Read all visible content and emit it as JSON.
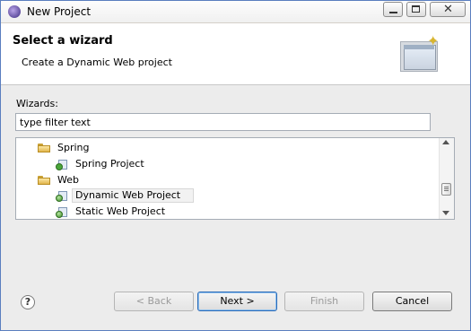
{
  "window": {
    "title": "New Project"
  },
  "header": {
    "title": "Select a wizard",
    "description": "Create a Dynamic Web project"
  },
  "wizards": {
    "label": "Wizards:",
    "filter_value": "type filter text",
    "tree": [
      {
        "label": "Spring",
        "icon": "folder-icon",
        "level": 0
      },
      {
        "label": "Spring Project",
        "icon": "spring-project-icon",
        "level": 1
      },
      {
        "label": "Web",
        "icon": "folder-icon",
        "level": 0
      },
      {
        "label": "Dynamic Web Project",
        "icon": "web-project-icon",
        "level": 1,
        "selected": true
      },
      {
        "label": "Static Web Project",
        "icon": "web-project-icon",
        "level": 1
      }
    ]
  },
  "buttons": {
    "help": "?",
    "back": "< Back",
    "next": "Next >",
    "finish": "Finish",
    "cancel": "Cancel"
  },
  "colors": {
    "window_border": "#5a7ebf",
    "default_button_border": "#2b6bb8"
  }
}
